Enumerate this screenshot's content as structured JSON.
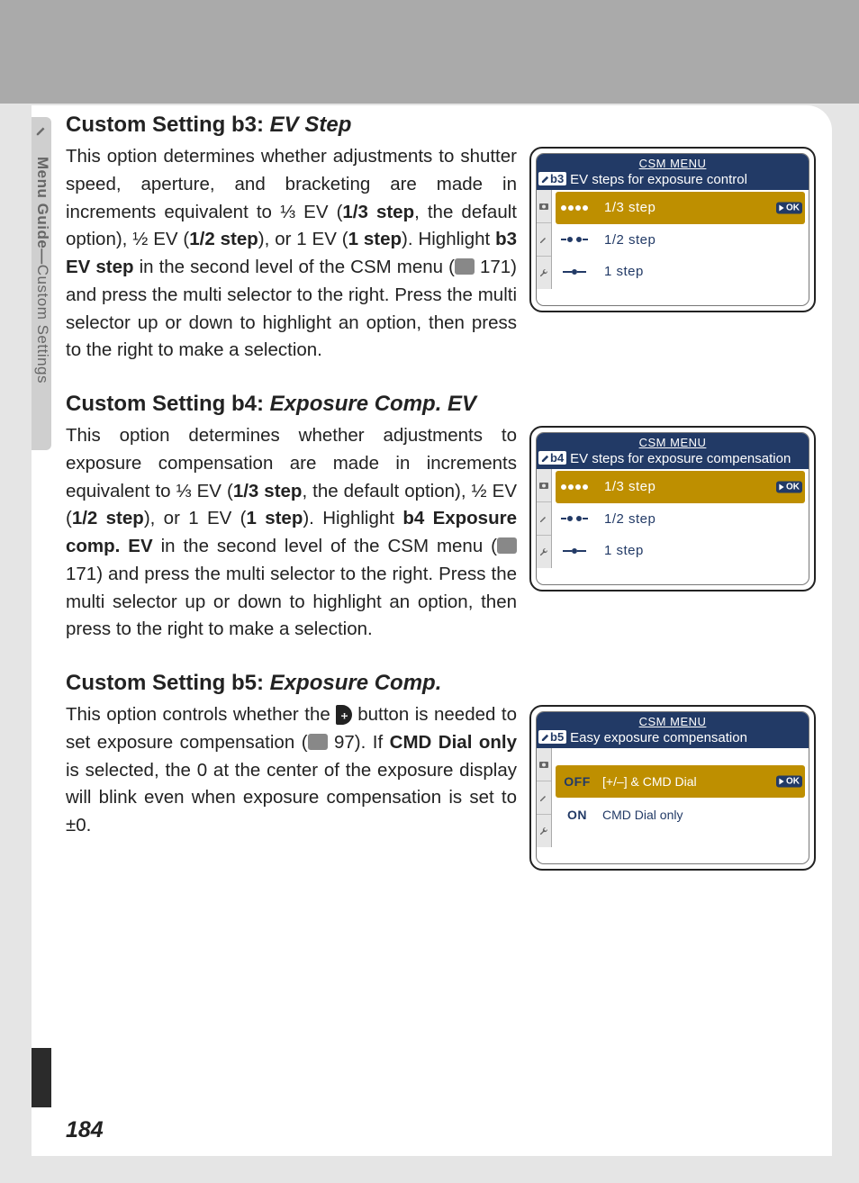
{
  "sidebar": {
    "label_bold": "Menu Guide—",
    "label_light": "Custom Settings"
  },
  "page_number": "184",
  "sections": {
    "b3": {
      "heading_prefix": "Custom Setting b3: ",
      "heading_name": "EV Step",
      "text_before": "This option determines whether adjustments to shutter speed, aperture, and bracketing are made in increments equivalent to ⅓ EV (",
      "bold1": "1/3 step",
      "text2": ", the default option), ½ EV (",
      "bold2": "1/2 step",
      "text3": "), or 1 EV (",
      "bold3": "1 step",
      "text4": "). Highlight ",
      "bold4": "b3 EV step",
      "text5": " in the second level of the CSM menu (",
      "page_ref": " 171) and press the multi selector to the right.  Press the multi selector up or down to highlight an option, then press to the right to make a selection."
    },
    "b4": {
      "heading_prefix": "Custom Setting b4: ",
      "heading_name": "Exposure Comp. EV",
      "text_before": "This option determines whether adjustments to exposure compensation are made in increments equivalent to ⅓ EV (",
      "bold1": "1/3 step",
      "text2": ", the default option), ½ EV (",
      "bold2": "1/2 step",
      "text3": "), or 1 EV (",
      "bold3": "1 step",
      "text4": ").  Highlight ",
      "bold4": "b4 Exposure comp. EV",
      "text5": " in the second level of the CSM menu (",
      "page_ref": " 171) and press the multi selector to the right.  Press the multi selector up or down to highlight an option, then press to the right to make a selection."
    },
    "b5": {
      "heading_prefix": "Custom Setting b5: ",
      "heading_name": "Exposure Comp.",
      "text_before": "This option controls whether the ",
      "ev_icon_text": "⧾",
      "text2": " button is needed to set exposure compensation (",
      "page_ref": " 97).  If ",
      "bold1": "CMD Dial only",
      "text3": " is selected, the 0 at the center of the exposure display will blink even when exposure compensation is set to ±0."
    }
  },
  "lcd": {
    "csm_label": "CSM MENU",
    "ok_label": "OK",
    "b3": {
      "badge": "b3",
      "subtitle": "EV steps for exposure control",
      "options": [
        {
          "label": "1/3 step",
          "selected": true,
          "dots": 3
        },
        {
          "label": "1/2 step",
          "selected": false,
          "dots": 2
        },
        {
          "label": " 1  step",
          "selected": false,
          "dots": 1
        }
      ]
    },
    "b4": {
      "badge": "b4",
      "subtitle": "EV steps for exposure compensation",
      "options": [
        {
          "label": "1/3 step",
          "selected": true,
          "dots": 3
        },
        {
          "label": "1/2 step",
          "selected": false,
          "dots": 2
        },
        {
          "label": " 1  step",
          "selected": false,
          "dots": 1
        }
      ]
    },
    "b5": {
      "badge": "b5",
      "subtitle": "Easy exposure compensation",
      "options": [
        {
          "code": "OFF",
          "desc": "[+/–] & CMD Dial",
          "selected": true
        },
        {
          "code": "ON",
          "desc": "CMD Dial only",
          "selected": false
        }
      ]
    }
  }
}
